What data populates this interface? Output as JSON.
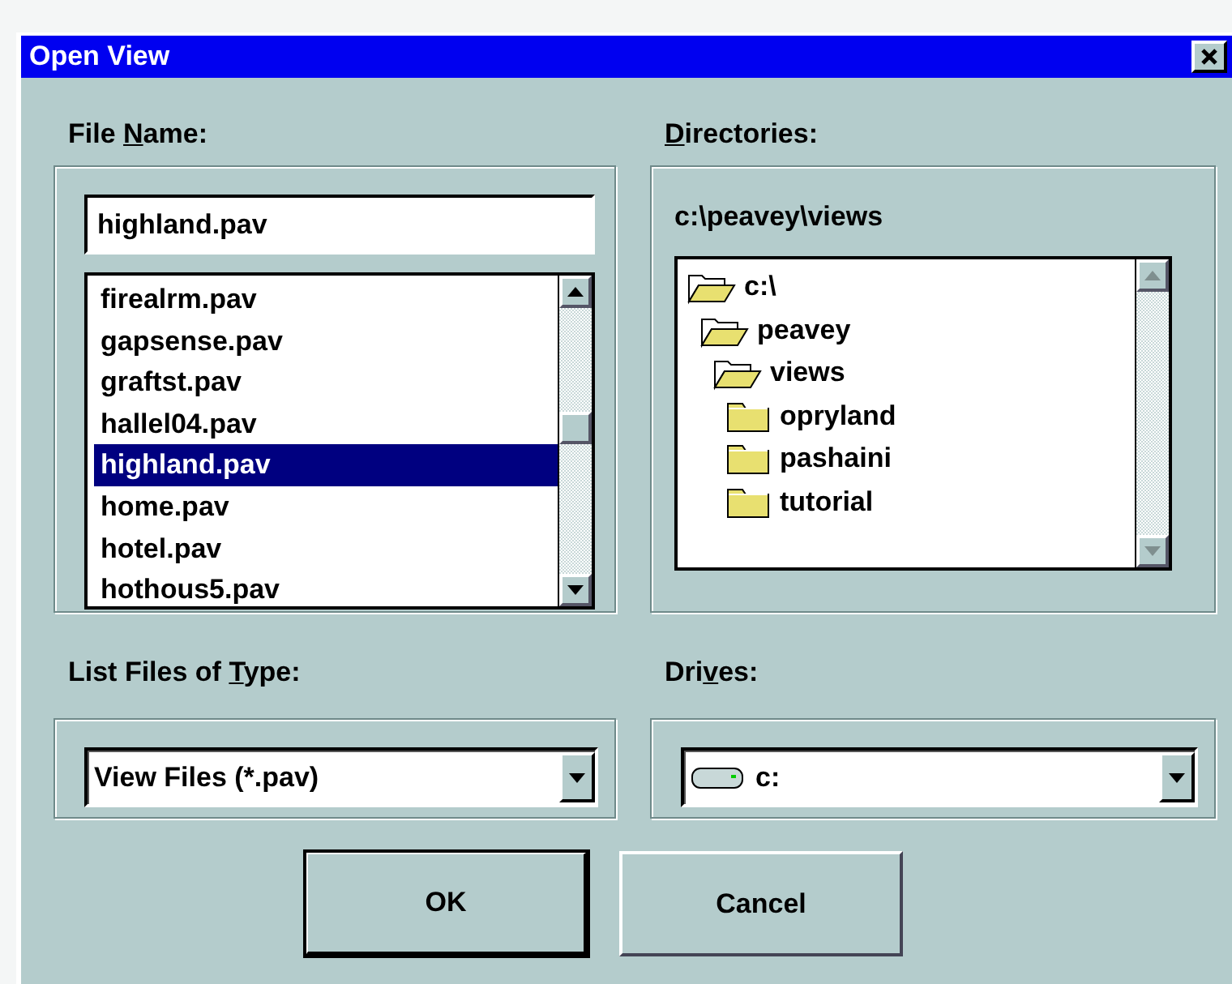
{
  "window": {
    "title": "Open View"
  },
  "file_name": {
    "label": [
      {
        "text": "File ",
        "underlined": false
      },
      {
        "text": "N",
        "underlined": true
      },
      {
        "text": "ame:",
        "underlined": false
      }
    ],
    "value": "highland.pav",
    "files": [
      {
        "name": "firealrm.pav",
        "selected": false
      },
      {
        "name": "gapsense.pav",
        "selected": false
      },
      {
        "name": "graftst.pav",
        "selected": false
      },
      {
        "name": "hallel04.pav",
        "selected": false
      },
      {
        "name": "highland.pav",
        "selected": true
      },
      {
        "name": "home.pav",
        "selected": false
      },
      {
        "name": "hotel.pav",
        "selected": false
      },
      {
        "name": "hothous5.pav",
        "selected": false
      }
    ]
  },
  "directories": {
    "label": [
      {
        "text": "D",
        "underlined": true
      },
      {
        "text": "irectories:",
        "underlined": false
      }
    ],
    "path": "c:\\peavey\\views",
    "tree": [
      {
        "name": "c:\\",
        "expanded": true,
        "children": [
          {
            "name": "peavey",
            "expanded": true,
            "children": [
              {
                "name": "views",
                "expanded": true,
                "children": [
                  {
                    "name": "opryland",
                    "expanded": false
                  },
                  {
                    "name": "pashaini",
                    "expanded": false
                  },
                  {
                    "name": "tutorial",
                    "expanded": false
                  }
                ]
              }
            ]
          }
        ]
      }
    ]
  },
  "file_type": {
    "label": [
      {
        "text": "List Files of ",
        "underlined": false
      },
      {
        "text": "T",
        "underlined": true
      },
      {
        "text": "ype:",
        "underlined": false
      }
    ],
    "value": "View Files (*.pav)"
  },
  "drives": {
    "label": [
      {
        "text": "Dri",
        "underlined": false
      },
      {
        "text": "v",
        "underlined": true
      },
      {
        "text": "es:",
        "underlined": false
      }
    ],
    "value": "c:"
  },
  "buttons": [
    {
      "label": "OK",
      "default": true
    },
    {
      "label": "Cancel",
      "default": false
    }
  ]
}
